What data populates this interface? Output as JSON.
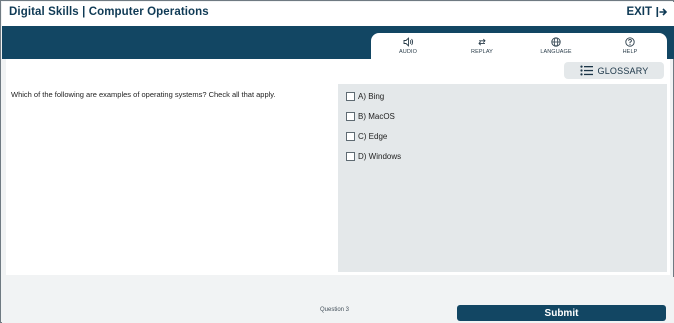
{
  "header": {
    "title": "Digital Skills | Computer Operations",
    "exit_label": "EXIT"
  },
  "toolbar": {
    "items": [
      {
        "label": "AUDIO",
        "icon": "speaker-icon"
      },
      {
        "label": "REPLAY",
        "icon": "replay-icon"
      },
      {
        "label": "LANGUAGE",
        "icon": "globe-icon"
      },
      {
        "label": "HELP",
        "icon": "help-icon"
      }
    ]
  },
  "glossary": {
    "label": "GLOSSARY",
    "icon": "list-icon"
  },
  "question": {
    "text": "Which of the following are examples of operating systems? Check all that apply.",
    "options": [
      {
        "label": "A) Bing",
        "checked": false
      },
      {
        "label": "B) MacOS",
        "checked": false
      },
      {
        "label": "C) Edge",
        "checked": false
      },
      {
        "label": "D) Windows",
        "checked": false
      }
    ]
  },
  "footer": {
    "question_number": "Question 3",
    "submit_label": "Submit"
  },
  "colors": {
    "brand_navy": "#124663",
    "panel_gray": "#e4e8ea",
    "background": "#f1f3f4"
  }
}
